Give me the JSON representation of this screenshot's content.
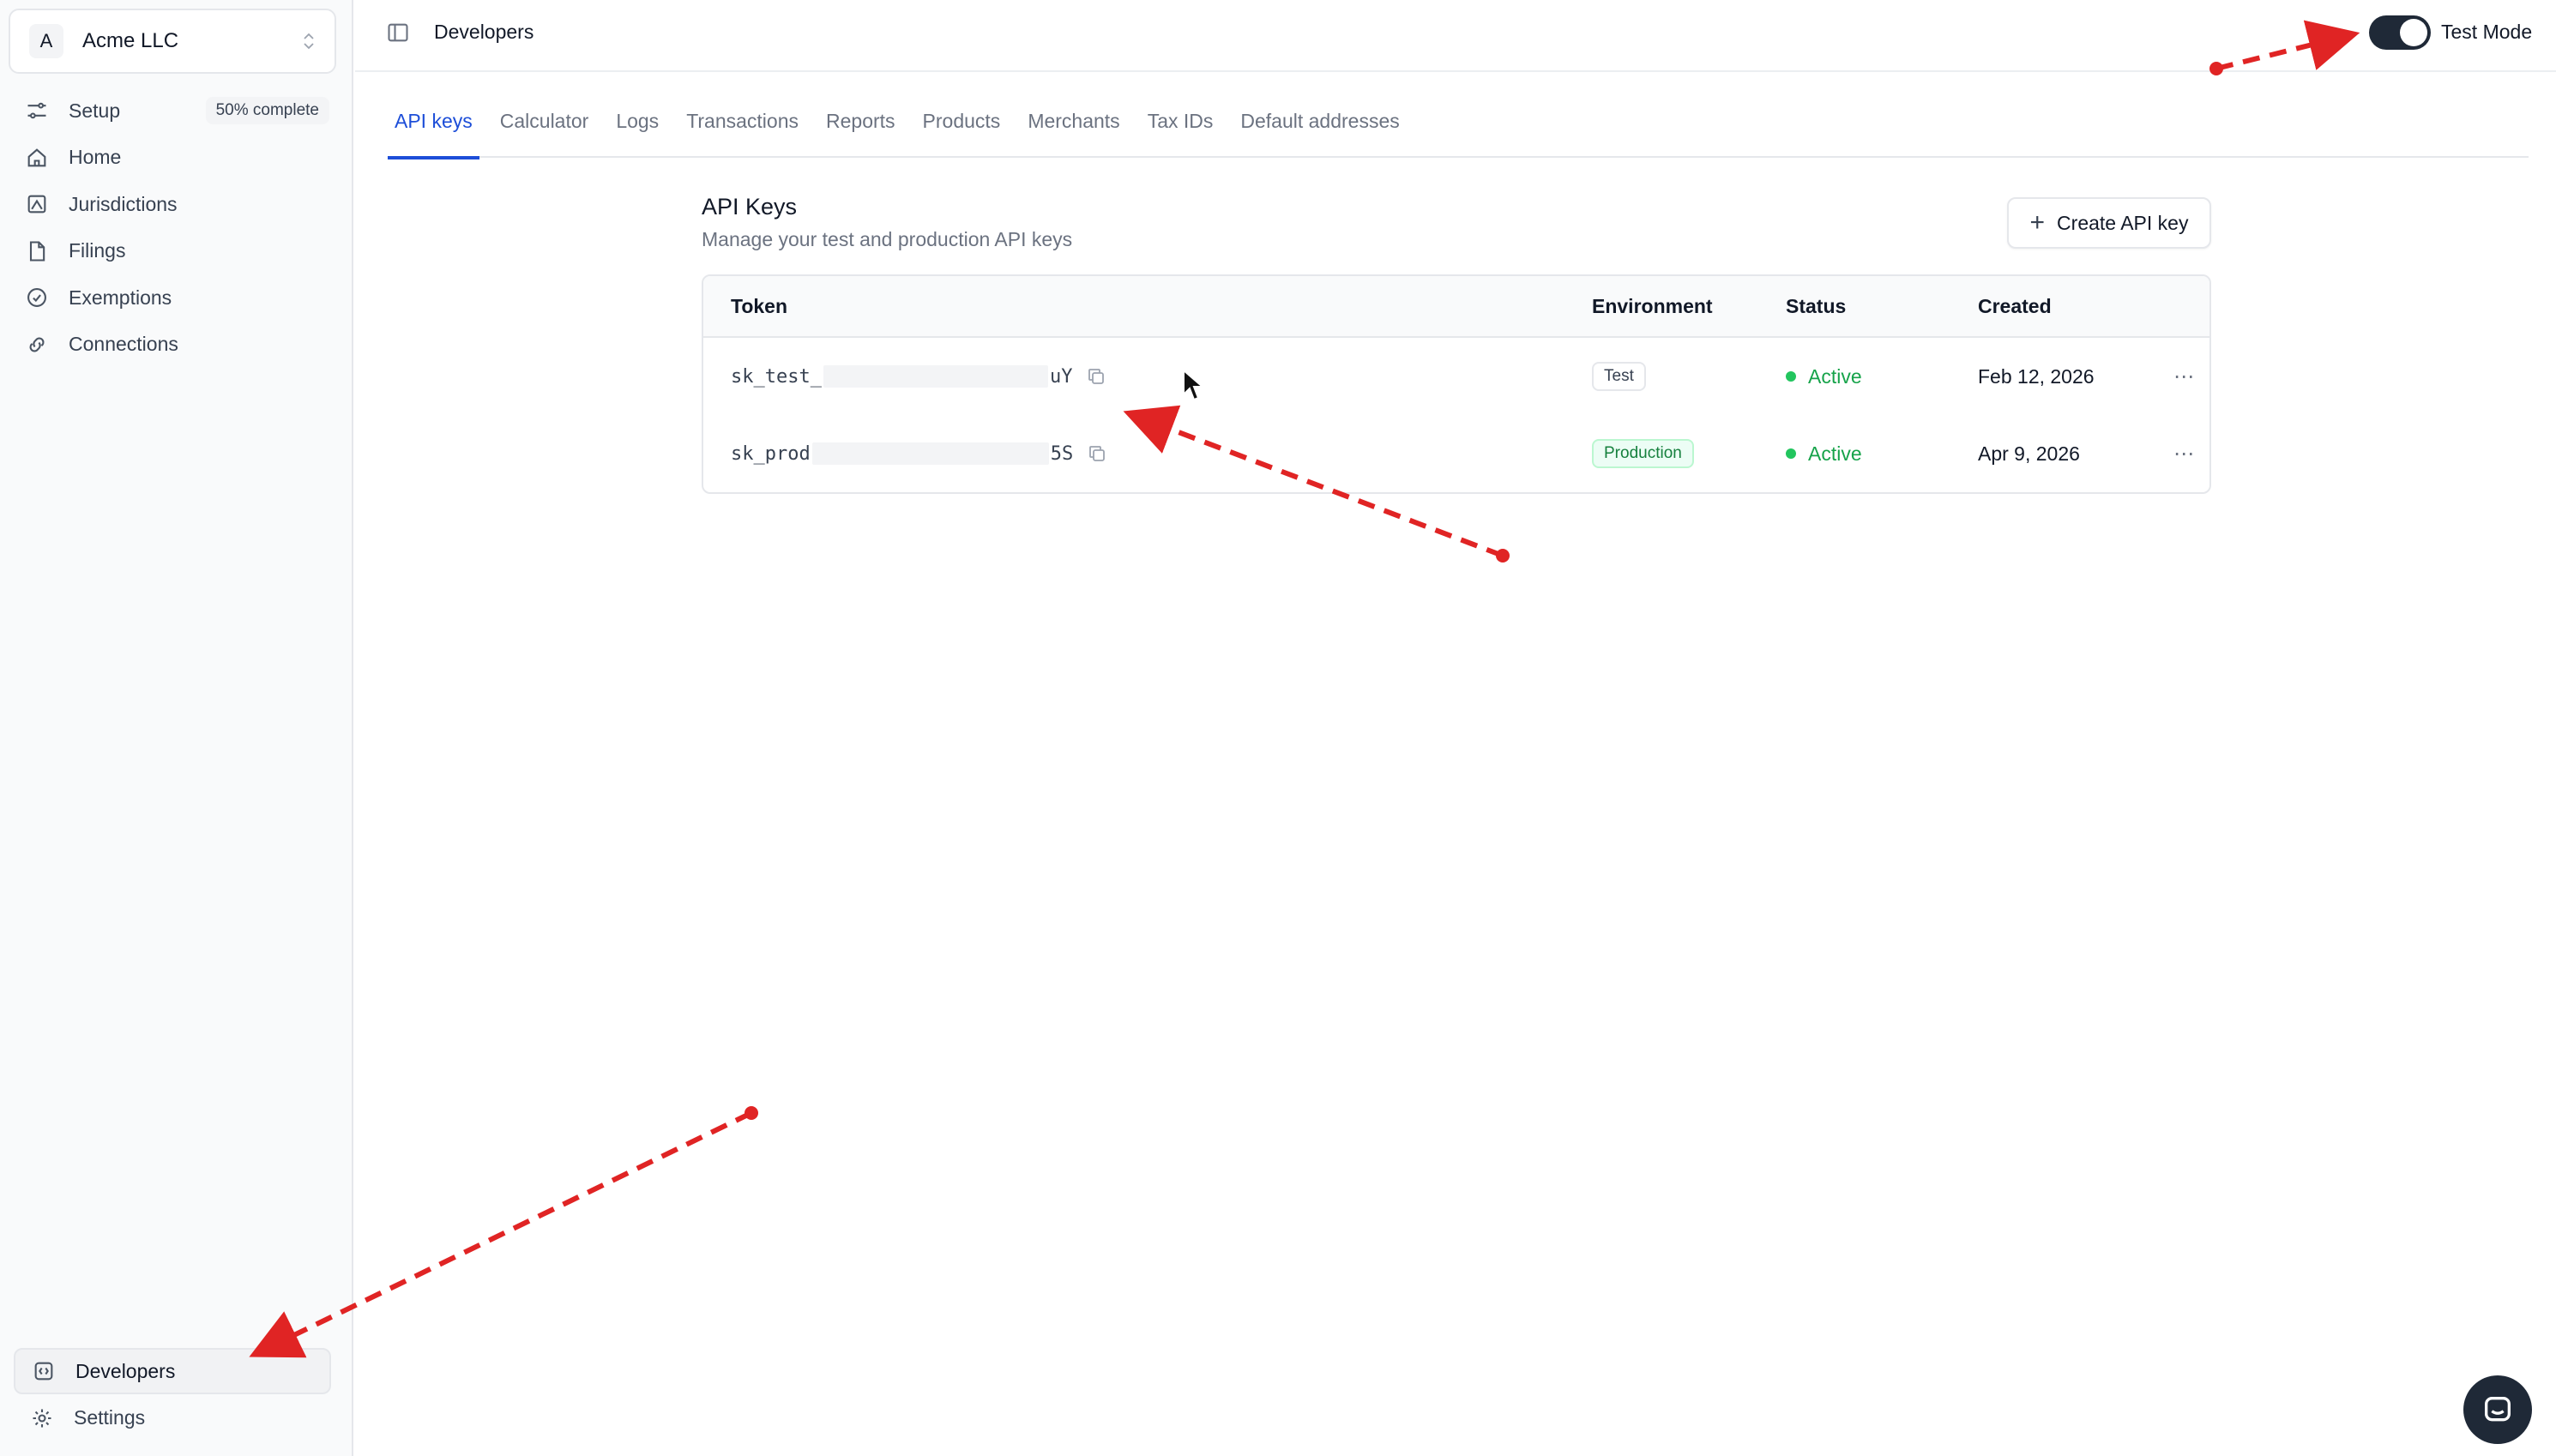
{
  "org": {
    "initial": "A",
    "name": "Acme LLC"
  },
  "sidebar": {
    "items": [
      {
        "label": "Setup",
        "badge": "50% complete",
        "icon": "sliders-icon"
      },
      {
        "label": "Home",
        "icon": "home-icon"
      },
      {
        "label": "Jurisdictions",
        "icon": "map-icon"
      },
      {
        "label": "Filings",
        "icon": "file-icon"
      },
      {
        "label": "Exemptions",
        "icon": "check-badge-icon"
      },
      {
        "label": "Connections",
        "icon": "link-icon"
      }
    ],
    "bottom": [
      {
        "label": "Developers",
        "icon": "code-icon",
        "active": true
      },
      {
        "label": "Settings",
        "icon": "gear-icon"
      }
    ]
  },
  "header": {
    "title": "Developers",
    "test_mode_label": "Test Mode",
    "test_mode_on": true
  },
  "tabs": [
    {
      "label": "API keys",
      "active": true
    },
    {
      "label": "Calculator"
    },
    {
      "label": "Logs"
    },
    {
      "label": "Transactions"
    },
    {
      "label": "Reports"
    },
    {
      "label": "Products"
    },
    {
      "label": "Merchants"
    },
    {
      "label": "Tax IDs"
    },
    {
      "label": "Default addresses"
    }
  ],
  "api_keys": {
    "title": "API Keys",
    "subtitle": "Manage your test and production API keys",
    "create_label": "Create API key",
    "columns": {
      "token": "Token",
      "environment": "Environment",
      "status": "Status",
      "created": "Created"
    },
    "rows": [
      {
        "token_prefix": "sk_test_",
        "token_suffix": "uY",
        "environment": "Test",
        "status": "Active",
        "created": "Feb 12, 2026"
      },
      {
        "token_prefix": "sk_prod",
        "token_suffix": "5S",
        "environment": "Production",
        "status": "Active",
        "created": "Apr 9, 2026"
      }
    ],
    "more_label": "⋯"
  },
  "colors": {
    "accent": "#1d4ed8",
    "active_status": "#16a34a",
    "annotation": "#e02424"
  }
}
